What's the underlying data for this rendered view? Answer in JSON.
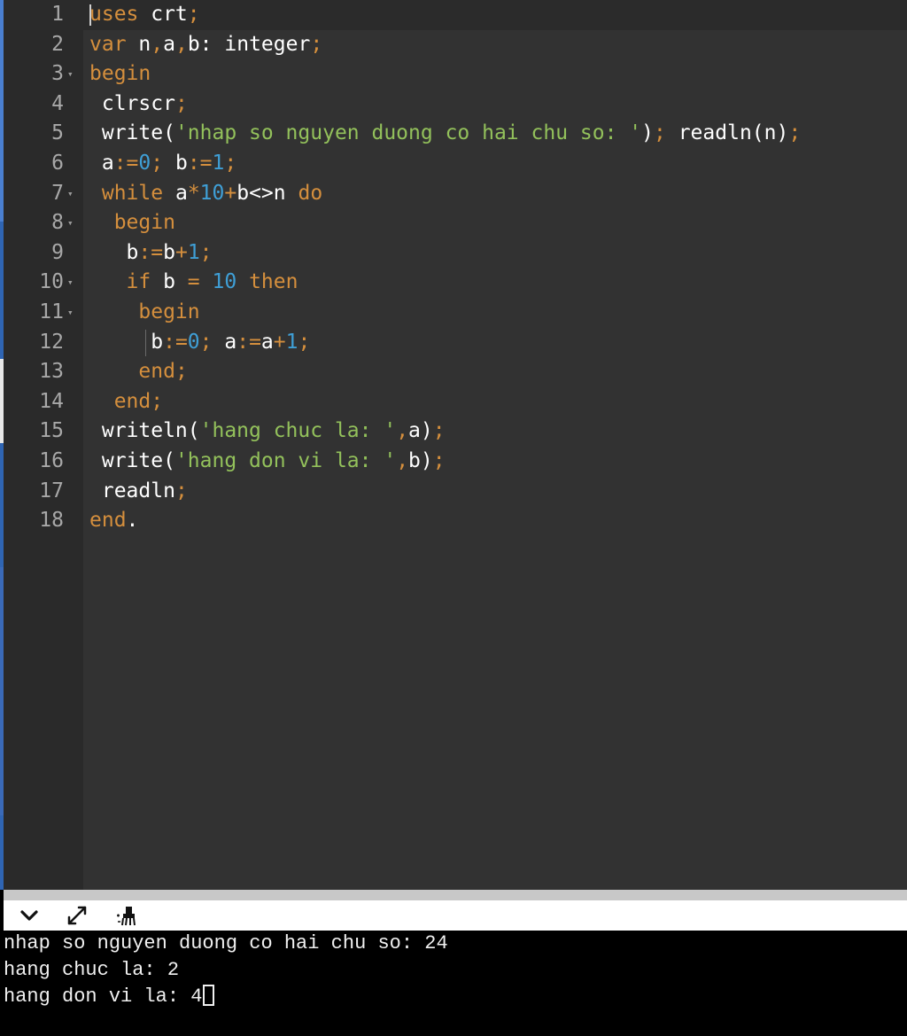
{
  "editor": {
    "lines": [
      {
        "n": "1",
        "fold": false,
        "tokens": [
          {
            "t": "uses",
            "c": "kw"
          },
          {
            "t": " crt"
          },
          {
            "t": ";",
            "c": "op"
          }
        ]
      },
      {
        "n": "2",
        "fold": false,
        "tokens": [
          {
            "t": "var",
            "c": "kw"
          },
          {
            "t": " n"
          },
          {
            "t": ",",
            "c": "op"
          },
          {
            "t": "a"
          },
          {
            "t": ",",
            "c": "op"
          },
          {
            "t": "b: integer"
          },
          {
            "t": ";",
            "c": "op"
          }
        ]
      },
      {
        "n": "3",
        "fold": true,
        "tokens": [
          {
            "t": "begin",
            "c": "kw"
          }
        ]
      },
      {
        "n": "4",
        "fold": false,
        "tokens": [
          {
            "t": " clrscr"
          },
          {
            "t": ";",
            "c": "op"
          }
        ]
      },
      {
        "n": "5",
        "fold": false,
        "tokens": [
          {
            "t": " write("
          },
          {
            "t": "'nhap so nguyen duong co hai chu so: '",
            "c": "str"
          },
          {
            "t": ")"
          },
          {
            "t": ";",
            "c": "op"
          },
          {
            "t": " readln(n)"
          },
          {
            "t": ";",
            "c": "op"
          }
        ]
      },
      {
        "n": "6",
        "fold": false,
        "tokens": [
          {
            "t": " a"
          },
          {
            "t": ":=",
            "c": "op"
          },
          {
            "t": "0",
            "c": "num"
          },
          {
            "t": ";",
            "c": "op"
          },
          {
            "t": " b"
          },
          {
            "t": ":=",
            "c": "op"
          },
          {
            "t": "1",
            "c": "num"
          },
          {
            "t": ";",
            "c": "op"
          }
        ]
      },
      {
        "n": "7",
        "fold": true,
        "tokens": [
          {
            "t": " "
          },
          {
            "t": "while",
            "c": "kw"
          },
          {
            "t": " a"
          },
          {
            "t": "*",
            "c": "op"
          },
          {
            "t": "10",
            "c": "num"
          },
          {
            "t": "+",
            "c": "op"
          },
          {
            "t": "b<>n "
          },
          {
            "t": "do",
            "c": "kw"
          }
        ]
      },
      {
        "n": "8",
        "fold": true,
        "tokens": [
          {
            "t": "  "
          },
          {
            "t": "begin",
            "c": "kw"
          }
        ]
      },
      {
        "n": "9",
        "fold": false,
        "tokens": [
          {
            "t": "   b"
          },
          {
            "t": ":=",
            "c": "op"
          },
          {
            "t": "b"
          },
          {
            "t": "+",
            "c": "op"
          },
          {
            "t": "1",
            "c": "num"
          },
          {
            "t": ";",
            "c": "op"
          }
        ]
      },
      {
        "n": "10",
        "fold": true,
        "tokens": [
          {
            "t": "   "
          },
          {
            "t": "if",
            "c": "kw"
          },
          {
            "t": " b "
          },
          {
            "t": "=",
            "c": "op"
          },
          {
            "t": " "
          },
          {
            "t": "10",
            "c": "num"
          },
          {
            "t": " "
          },
          {
            "t": "then",
            "c": "kw"
          }
        ]
      },
      {
        "n": "11",
        "fold": true,
        "tokens": [
          {
            "t": "    "
          },
          {
            "t": "begin",
            "c": "kw"
          }
        ]
      },
      {
        "n": "12",
        "fold": false,
        "tokens": [
          {
            "t": "     b"
          },
          {
            "t": ":=",
            "c": "op"
          },
          {
            "t": "0",
            "c": "num"
          },
          {
            "t": ";",
            "c": "op"
          },
          {
            "t": " a"
          },
          {
            "t": ":=",
            "c": "op"
          },
          {
            "t": "a"
          },
          {
            "t": "+",
            "c": "op"
          },
          {
            "t": "1",
            "c": "num"
          },
          {
            "t": ";",
            "c": "op"
          }
        ]
      },
      {
        "n": "13",
        "fold": false,
        "tokens": [
          {
            "t": "    "
          },
          {
            "t": "end",
            "c": "kw"
          },
          {
            "t": ";",
            "c": "op"
          }
        ]
      },
      {
        "n": "14",
        "fold": false,
        "tokens": [
          {
            "t": "  "
          },
          {
            "t": "end",
            "c": "kw"
          },
          {
            "t": ";",
            "c": "op"
          }
        ]
      },
      {
        "n": "15",
        "fold": false,
        "tokens": [
          {
            "t": " writeln("
          },
          {
            "t": "'hang chuc la: '",
            "c": "str"
          },
          {
            "t": ",",
            "c": "op"
          },
          {
            "t": "a)"
          },
          {
            "t": ";",
            "c": "op"
          }
        ]
      },
      {
        "n": "16",
        "fold": false,
        "tokens": [
          {
            "t": " write("
          },
          {
            "t": "'hang don vi la: '",
            "c": "str"
          },
          {
            "t": ",",
            "c": "op"
          },
          {
            "t": "b)"
          },
          {
            "t": ";",
            "c": "op"
          }
        ]
      },
      {
        "n": "17",
        "fold": false,
        "tokens": [
          {
            "t": " readln"
          },
          {
            "t": ";",
            "c": "op"
          }
        ]
      },
      {
        "n": "18",
        "fold": false,
        "tokens": [
          {
            "t": "end",
            "c": "kw"
          },
          {
            "t": "."
          }
        ]
      }
    ]
  },
  "toolbar": {
    "buttons": [
      {
        "name": "collapse-console-button",
        "icon": "chevron-down-icon"
      },
      {
        "name": "expand-console-button",
        "icon": "expand-icon"
      },
      {
        "name": "clear-console-button",
        "icon": "clear-icon"
      }
    ]
  },
  "console": {
    "lines": [
      "nhap so nguyen duong co hai chu so: 24",
      "hang chuc la: 2",
      "hang don vi la: 4"
    ]
  },
  "colors": {
    "keyword": "#d58f3d",
    "string": "#93c15b",
    "number": "#3f9fd6",
    "text": "#ffffff",
    "editor_bg": "#323232",
    "console_bg": "#000000"
  }
}
